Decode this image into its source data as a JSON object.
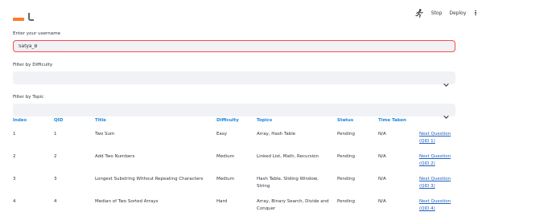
{
  "toolbar": {
    "running_icon": "running-man-icon",
    "stop_label": "Stop",
    "deploy_label": "Deploy",
    "menu_icon": "vertical-ellipsis-icon"
  },
  "colors": {
    "accent": "#ff4b4b",
    "header_blue": "#1c83e1",
    "link_blue": "#1f5fbf",
    "input_bg": "#f0f2f6",
    "title_orange": "#ff7a2f"
  },
  "form": {
    "username_label": "Enter your username",
    "username_value": "Satya_B",
    "difficulty_label": "Filter by Difficulty",
    "difficulty_value": "",
    "topic_label": "Filter by Topic",
    "topic_value": ""
  },
  "table": {
    "headers": [
      "Index",
      "QID",
      "Title",
      "Difficulty",
      "Topics",
      "Status",
      "Time Taken",
      ""
    ],
    "rows": [
      {
        "index": "1",
        "qid": "1",
        "title": "Two Sum",
        "difficulty": "Easy",
        "topics": "Array, Hash Table",
        "status": "Pending",
        "time": "N/A",
        "link_line1": "Next Question",
        "link_line2": "(QID 1)"
      },
      {
        "index": "2",
        "qid": "2",
        "title": "Add Two Numbers",
        "difficulty": "Medium",
        "topics": "Linked List, Math, Recursion",
        "status": "Pending",
        "time": "N/A",
        "link_line1": "Next Question",
        "link_line2": "(QID 2)"
      },
      {
        "index": "3",
        "qid": "3",
        "title": "Longest Substring Without Repeating Characters",
        "difficulty": "Medium",
        "topics": "Hash Table, Sliding Window, String",
        "status": "Pending",
        "time": "N/A",
        "link_line1": "Next Question",
        "link_line2": "(QID 3)"
      },
      {
        "index": "4",
        "qid": "4",
        "title": "Median of Two Sorted Arrays",
        "difficulty": "Hard",
        "topics": "Array, Binary Search, Divide and Conquer",
        "status": "Pending",
        "time": "N/A",
        "link_line1": "Next Question",
        "link_line2": "(QID 4)"
      }
    ]
  }
}
